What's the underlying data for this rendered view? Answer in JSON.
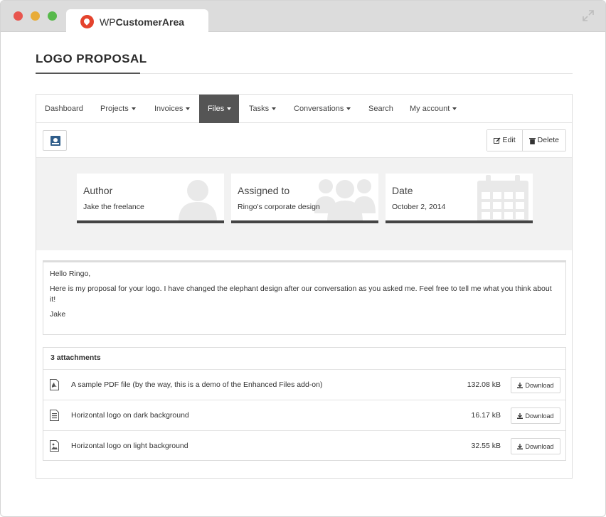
{
  "browser": {
    "tab_title_prefix": "WP",
    "tab_title_bold": "CustomerArea"
  },
  "page": {
    "title": "LOGO PROPOSAL"
  },
  "nav": {
    "items": [
      {
        "label": "Dashboard",
        "dropdown": false
      },
      {
        "label": "Projects",
        "dropdown": true
      },
      {
        "label": "Invoices",
        "dropdown": true
      },
      {
        "label": "Files",
        "dropdown": true,
        "active": true
      },
      {
        "label": "Tasks",
        "dropdown": true
      },
      {
        "label": "Conversations",
        "dropdown": true
      },
      {
        "label": "Search",
        "dropdown": false
      },
      {
        "label": "My account",
        "dropdown": true
      }
    ]
  },
  "toolbar": {
    "edit_label": "Edit",
    "delete_label": "Delete"
  },
  "meta": {
    "author": {
      "label": "Author",
      "value": "Jake the freelance",
      "icon": "user-icon"
    },
    "assigned": {
      "label": "Assigned to",
      "value": "Ringo's corporate design",
      "icon": "group-icon"
    },
    "date": {
      "label": "Date",
      "value": "October 2, 2014",
      "icon": "calendar-icon"
    }
  },
  "message": {
    "greeting": "Hello Ringo,",
    "body": "Here is my proposal for your logo. I have changed the elephant design after our conversation as you asked me. Feel free to tell me what you think about it!",
    "signature": "Jake"
  },
  "attachments": {
    "header": "3 attachments",
    "download_label": "Download",
    "items": [
      {
        "name": "A sample PDF file (by the way, this is a demo of the Enhanced Files add-on)",
        "size": "132.08 kB",
        "icon": "pdf-file-icon"
      },
      {
        "name": "Horizontal logo on dark background",
        "size": "16.17 kB",
        "icon": "text-file-icon"
      },
      {
        "name": "Horizontal logo on light background",
        "size": "32.55 kB",
        "icon": "image-file-icon"
      }
    ]
  },
  "colors": {
    "accent": "#555555",
    "brand": "#e4432d"
  }
}
